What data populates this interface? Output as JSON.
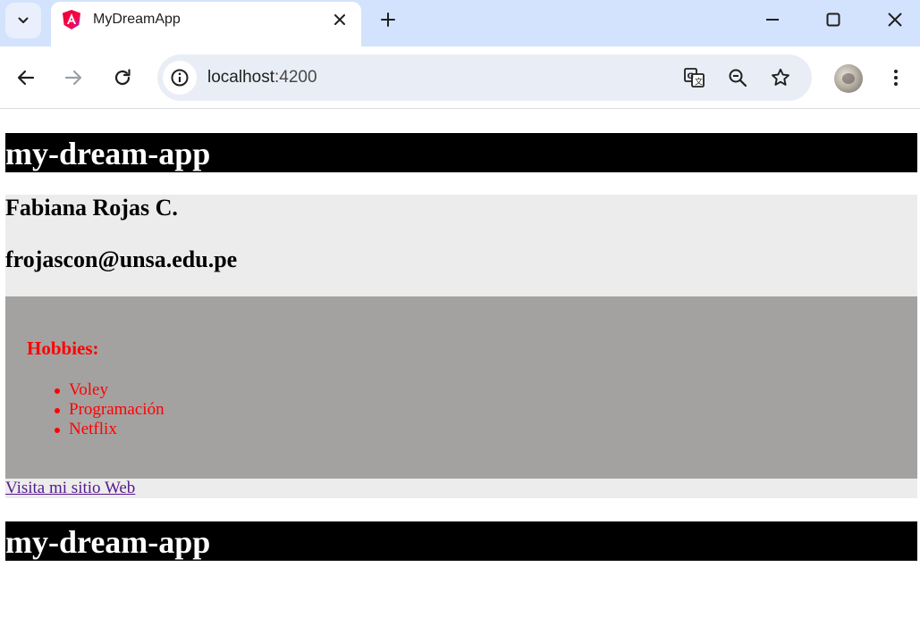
{
  "browser": {
    "tab_title": "MyDreamApp",
    "url_host": "localhost",
    "url_port": ":4200"
  },
  "page": {
    "banner_top": "my-dream-app",
    "name": "Fabiana Rojas C.",
    "email": "frojascon@unsa.edu.pe",
    "hobbies_title": "Hobbies:",
    "hobbies": [
      "Voley",
      "Programación",
      "Netflix"
    ],
    "link_text": "Visita mi sitio Web",
    "banner_bottom": "my-dream-app"
  },
  "colors": {
    "tabstrip": "#d3e3fd",
    "hobbies_bg": "#a3a2a0",
    "profile_bg": "#ececec",
    "hobbies_text": "#ff0000",
    "visited_link": "#551a8b"
  }
}
